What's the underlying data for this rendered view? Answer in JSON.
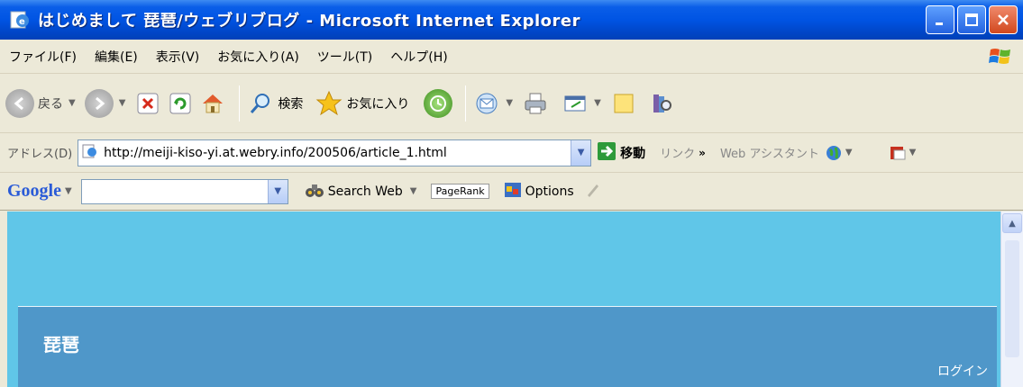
{
  "window": {
    "title": "はじめまして 琵琶/ウェブリブログ - Microsoft Internet Explorer"
  },
  "menu": {
    "items": [
      "ファイル(F)",
      "編集(E)",
      "表示(V)",
      "お気に入り(A)",
      "ツール(T)",
      "ヘルプ(H)"
    ]
  },
  "toolbar": {
    "back_label": "戻る",
    "search_label": "検索",
    "favorites_label": "お気に入り"
  },
  "address": {
    "label": "アドレス(D)",
    "url": "http://meiji-kiso-yi.at.webry.info/200506/article_1.html",
    "go_label": "移動",
    "links_label": "リンク",
    "links_arrow": "»",
    "web_assistant": "Web アシスタント"
  },
  "google": {
    "logo": "Google",
    "search_web": "Search Web",
    "pagerank": "PageRank",
    "options": "Options"
  },
  "page": {
    "blog_title": "琵琶",
    "login": "ログイン"
  },
  "colors": {
    "title_bar": "#0054e3",
    "page_background": "#60c6e8",
    "blog_header": "#4f97c9"
  }
}
